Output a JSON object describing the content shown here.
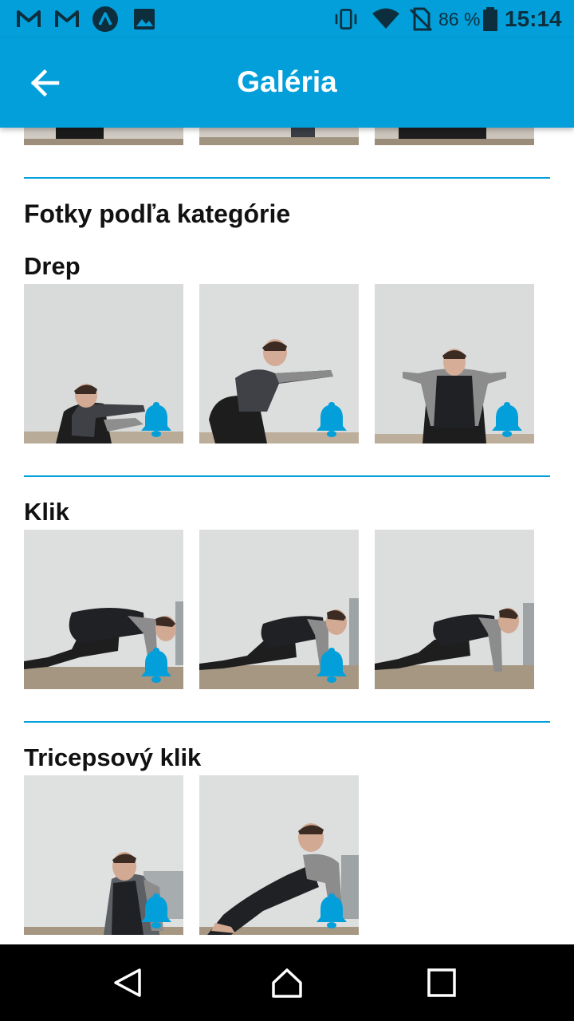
{
  "status_bar": {
    "battery_percent": "86 %",
    "time": "15:14",
    "icons": [
      "gmail-icon",
      "gmail-icon",
      "arc-app-icon",
      "image-icon",
      "vibrate-icon",
      "wifi-icon",
      "no-sim-icon",
      "battery-icon"
    ]
  },
  "app_bar": {
    "title": "Galéria",
    "back_icon": "arrow-back-icon",
    "color": "#039fda"
  },
  "section": {
    "title": "Fotky podľa kategórie"
  },
  "categories": [
    {
      "name": "Drep",
      "photo_count": 3
    },
    {
      "name": "Klik",
      "photo_count": 3
    },
    {
      "name": "Tricepsový klik",
      "photo_count": 2
    }
  ],
  "photo_badge_icon": "bell-icon",
  "nav_bar": {
    "icons": [
      "back-triangle-icon",
      "home-icon",
      "recents-square-icon"
    ]
  }
}
